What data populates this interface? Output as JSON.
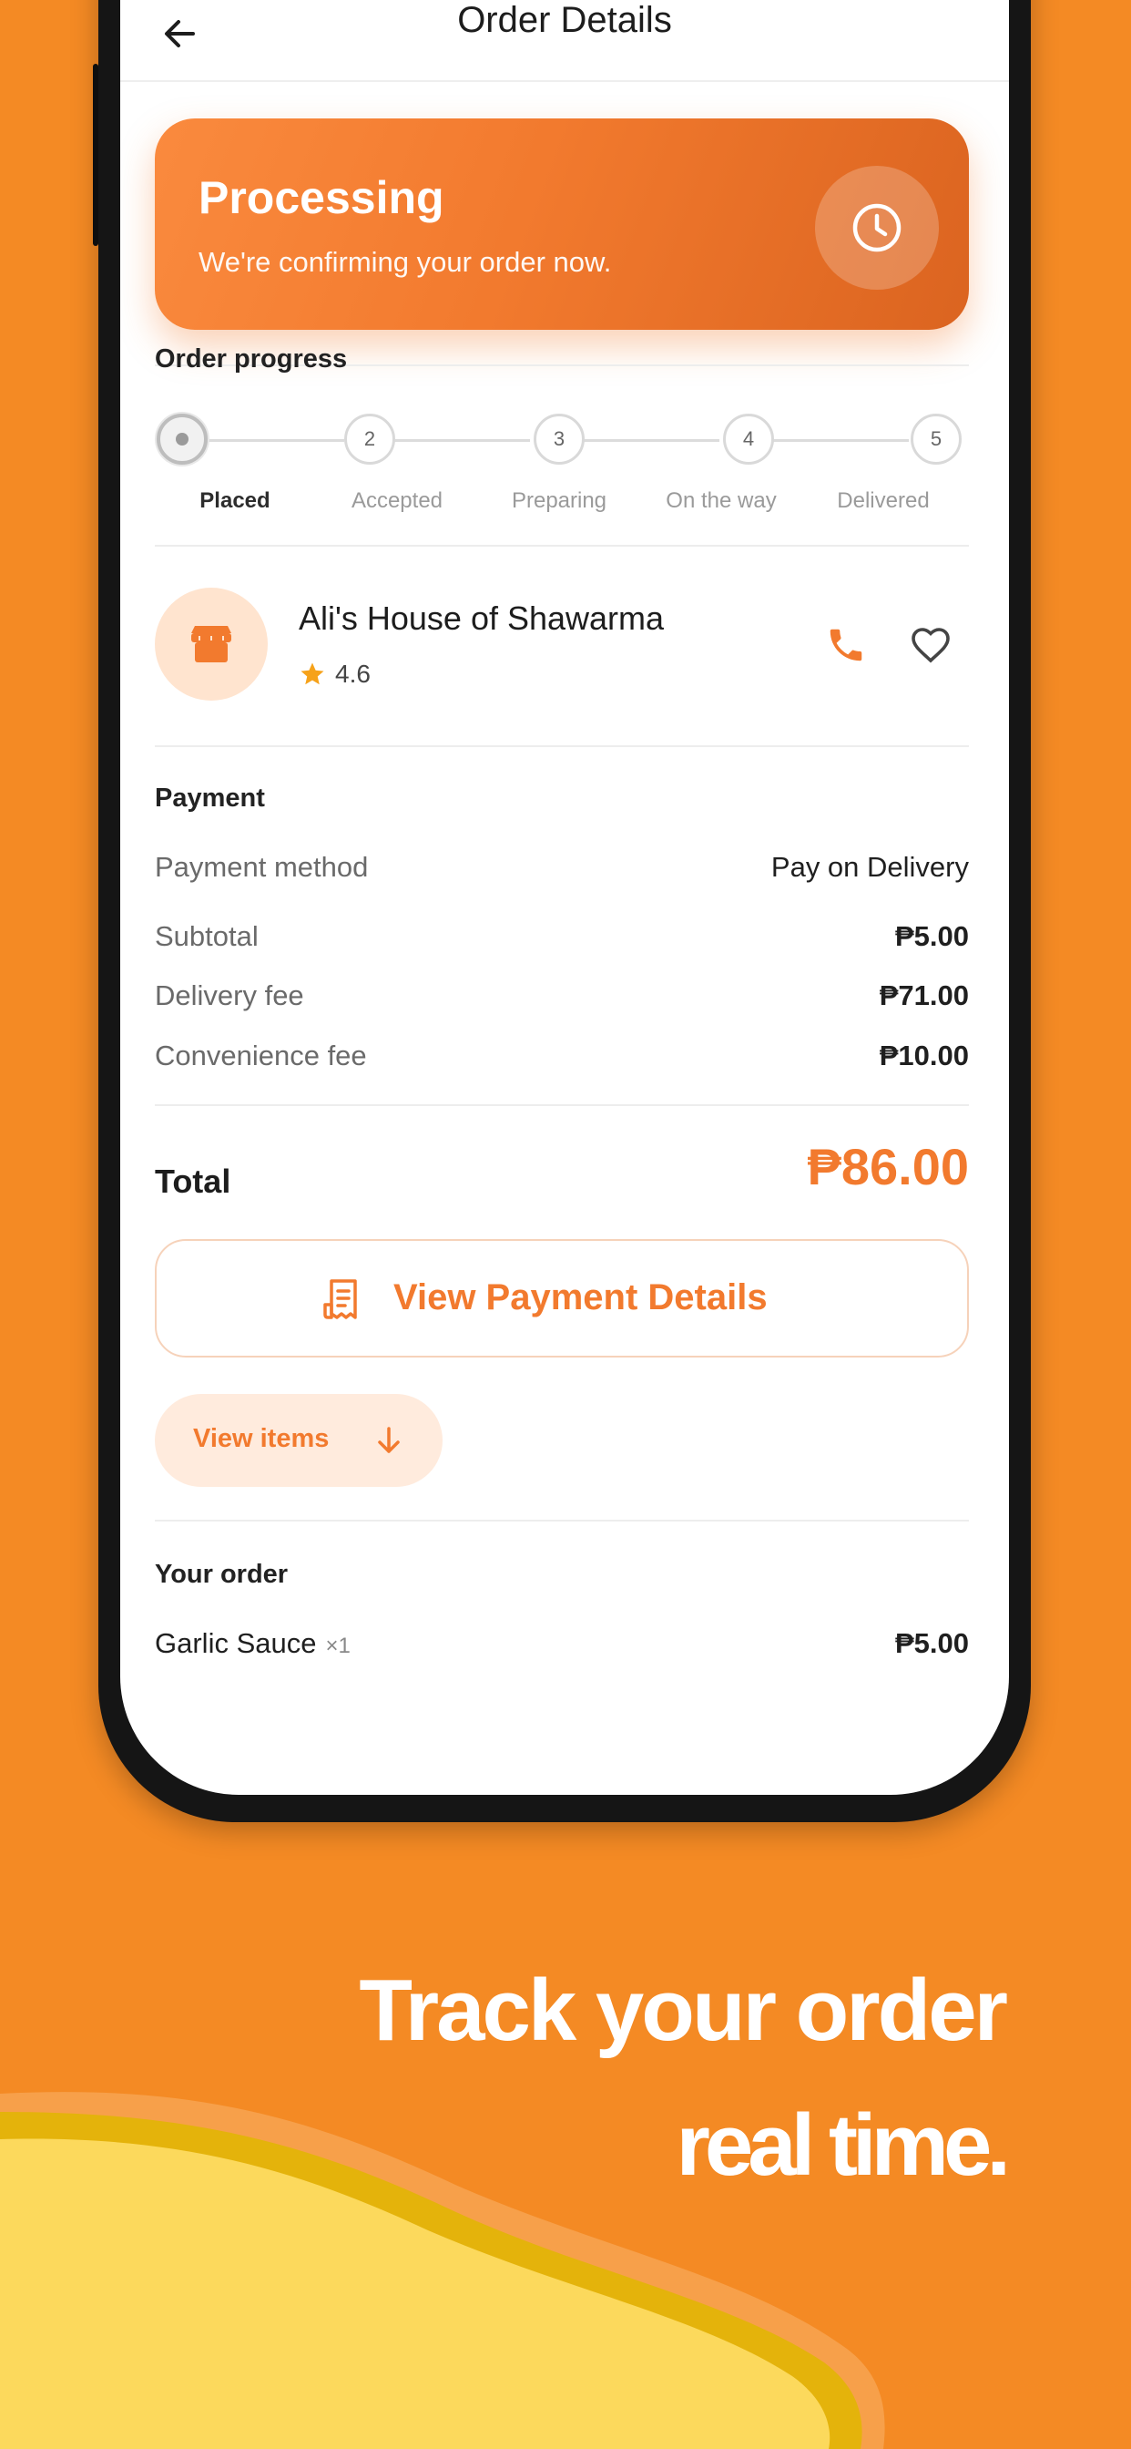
{
  "header": {
    "title": "Order Details"
  },
  "status": {
    "title": "Processing",
    "subtitle": "We're confirming your order now."
  },
  "progress": {
    "label": "Order progress",
    "steps": [
      {
        "number": "",
        "label": "Placed",
        "active": true
      },
      {
        "number": "2",
        "label": "Accepted",
        "active": false
      },
      {
        "number": "3",
        "label": "Preparing",
        "active": false
      },
      {
        "number": "4",
        "label": "On the way",
        "active": false
      },
      {
        "number": "5",
        "label": "Delivered",
        "active": false
      }
    ]
  },
  "restaurant": {
    "name": "Ali's House of Shawarma",
    "rating": "4.6"
  },
  "payment": {
    "label": "Payment",
    "rows": [
      {
        "label": "Payment method",
        "value": "Pay on Delivery"
      },
      {
        "label": "Subtotal",
        "value": "₱5.00"
      },
      {
        "label": "Delivery fee",
        "value": "₱71.00"
      },
      {
        "label": "Convenience fee",
        "value": "₱10.00"
      }
    ],
    "total_label": "Total",
    "total_value": "₱86.00",
    "details_button": "View Payment Details",
    "items_button": "View items"
  },
  "order": {
    "label": "Your order",
    "items": [
      {
        "name": "Garlic Sauce",
        "qty": "×1",
        "price": "₱5.00"
      }
    ]
  },
  "promo": {
    "line1": "Track your order",
    "line2": "real time."
  },
  "colors": {
    "accent": "#F27A2E",
    "background": "#F48A24",
    "wave": "#FCD95C"
  }
}
